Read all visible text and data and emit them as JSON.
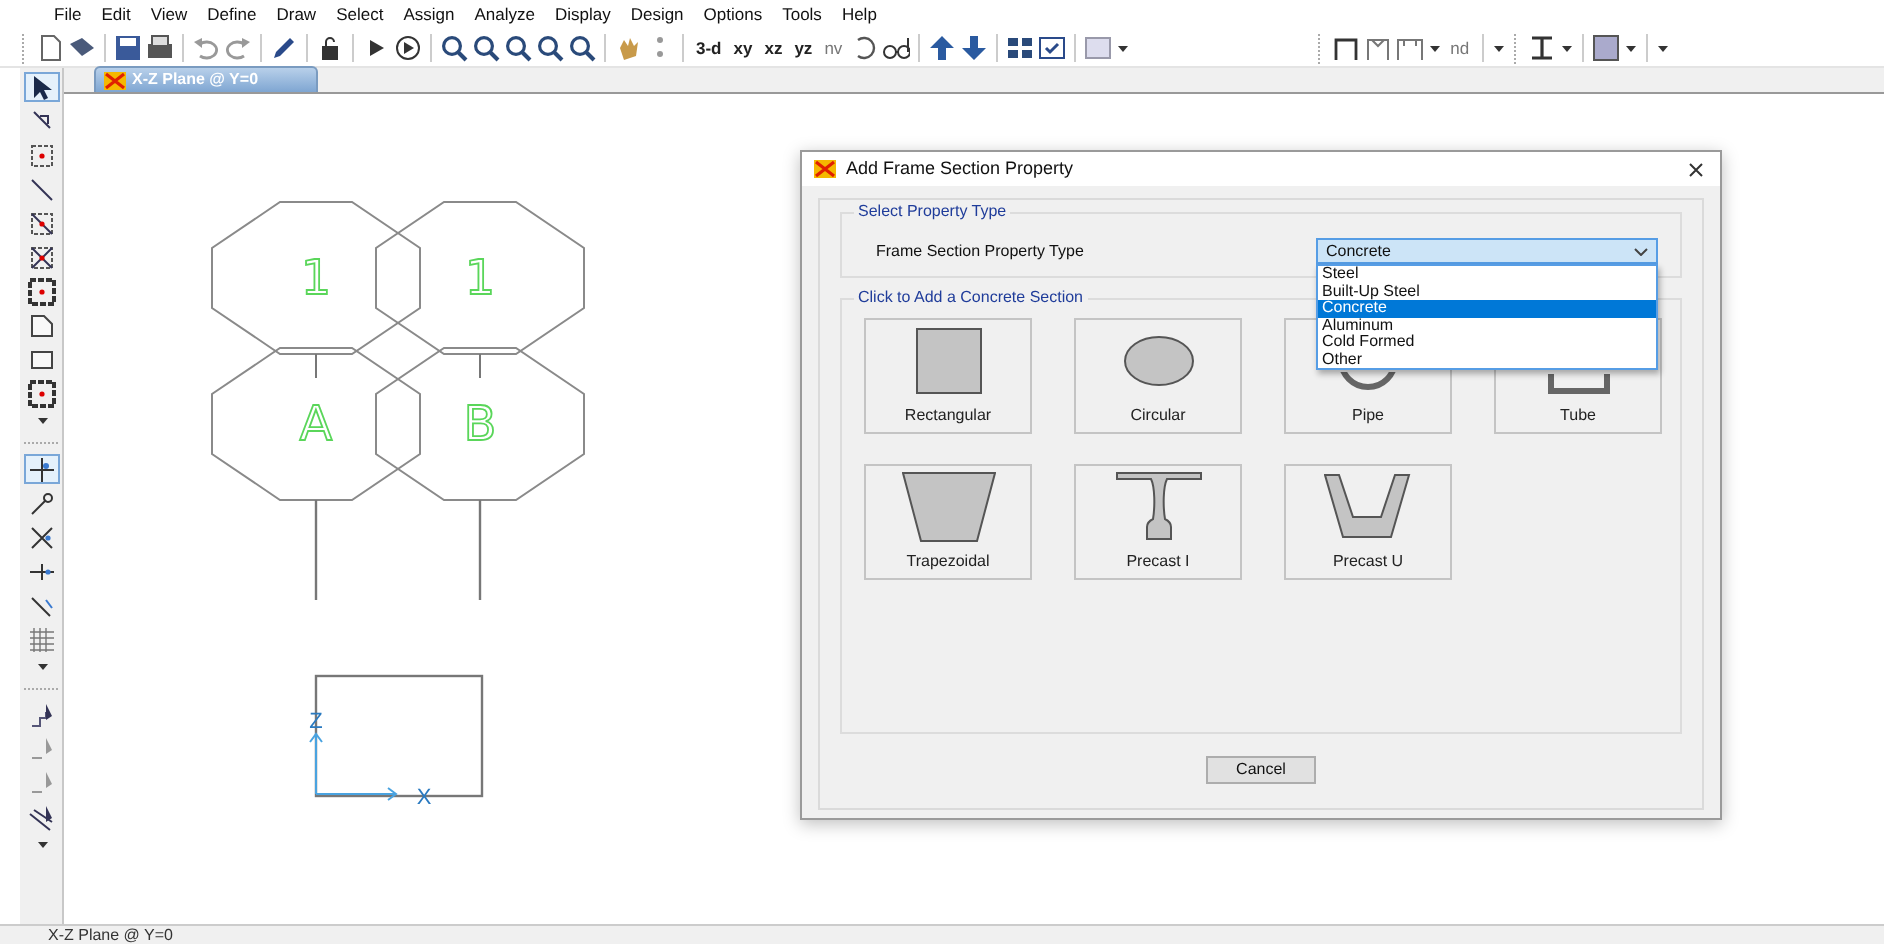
{
  "menu": [
    "File",
    "Edit",
    "View",
    "Define",
    "Draw",
    "Select",
    "Assign",
    "Analyze",
    "Display",
    "Design",
    "Options",
    "Tools",
    "Help"
  ],
  "toolbar_texts": [
    "3-d",
    "xy",
    "xz",
    "yz",
    "nv",
    "nd"
  ],
  "tab": {
    "title": "X-Z Plane @ Y=0",
    "selected": true
  },
  "canvas": {
    "grid_bubbles": [
      {
        "label": "1"
      },
      {
        "label": "1"
      },
      {
        "label": "A"
      },
      {
        "label": "B"
      }
    ],
    "axes": {
      "z": "Z",
      "x": "X"
    }
  },
  "dialog": {
    "title": "Add Frame Section Property",
    "property_group": {
      "title": "Select Property Type",
      "label": "Frame Section Property Type",
      "value": "Concrete",
      "expanded": true,
      "options": [
        {
          "label": "Steel",
          "selected": false
        },
        {
          "label": "Built-Up Steel",
          "selected": false
        },
        {
          "label": "Concrete",
          "selected": true
        },
        {
          "label": "Aluminum",
          "selected": false
        },
        {
          "label": "Cold Formed",
          "selected": false
        },
        {
          "label": "Other",
          "selected": false
        }
      ]
    },
    "sections_group": {
      "title": "Click to Add a Concrete Section",
      "sections": [
        {
          "kind": "rectangular",
          "label": "Rectangular"
        },
        {
          "kind": "circular",
          "label": "Circular"
        },
        {
          "kind": "pipe",
          "label": "Pipe"
        },
        {
          "kind": "tube",
          "label": "Tube"
        },
        {
          "kind": "trapezoidal",
          "label": "Trapezoidal"
        },
        {
          "kind": "precast_i",
          "label": "Precast I"
        },
        {
          "kind": "precast_u",
          "label": "Precast U"
        }
      ]
    },
    "cancel": "Cancel"
  },
  "status_bar": "X-Z Plane @ Y=0"
}
